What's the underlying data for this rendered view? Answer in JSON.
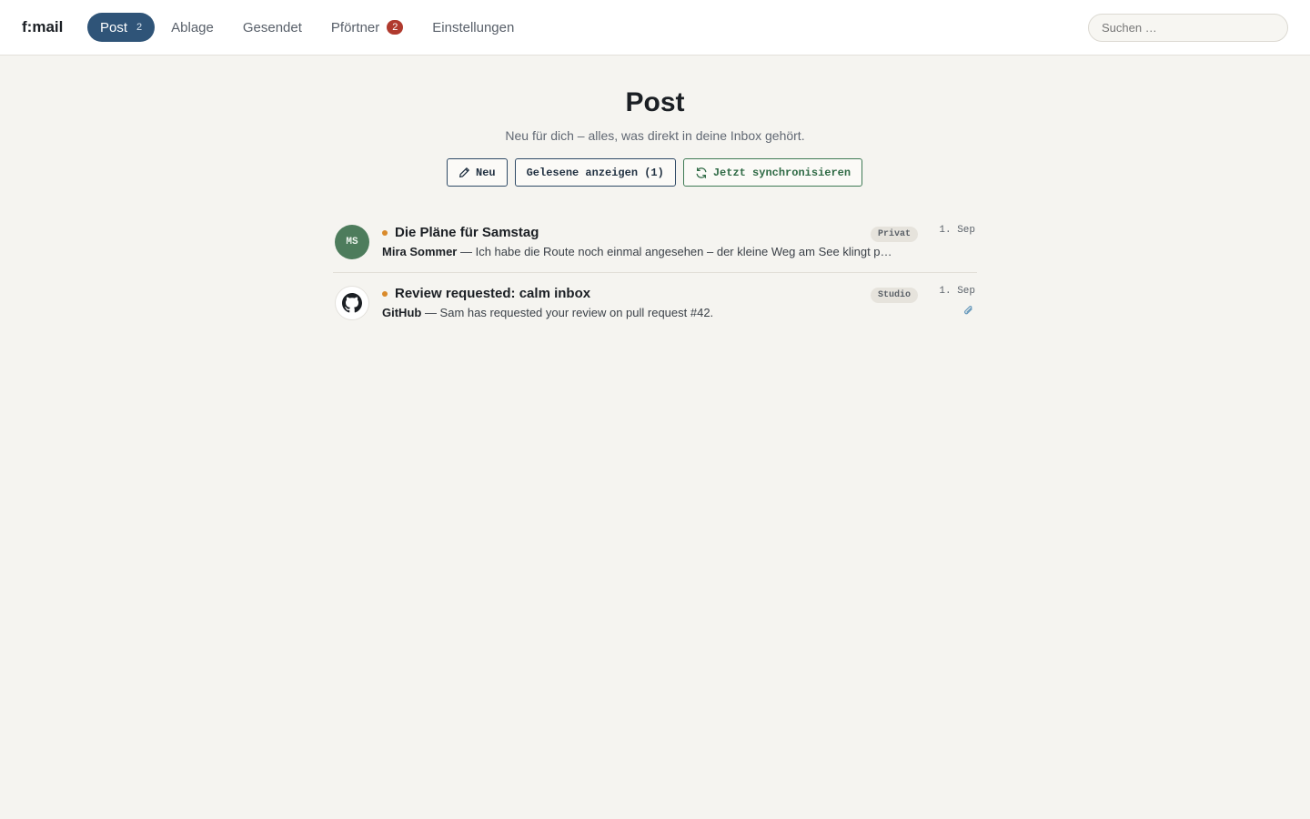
{
  "app": {
    "logo": "f:mail"
  },
  "nav": {
    "items": [
      {
        "label": "Post",
        "count": "2",
        "active": true
      },
      {
        "label": "Ablage"
      },
      {
        "label": "Gesendet"
      },
      {
        "label": "Pförtner",
        "badge": "2"
      },
      {
        "label": "Einstellungen"
      }
    ]
  },
  "search": {
    "placeholder": "Suchen …",
    "value": ""
  },
  "main": {
    "title": "Post",
    "subtitle": "Neu für dich – alles, was direkt in deine Inbox gehört.",
    "actions": {
      "new_label": "Neu",
      "show_read_label": "Gelesene anzeigen (1)",
      "sync_label": "Jetzt synchronisieren"
    }
  },
  "mails": [
    {
      "avatar_initials": "MS",
      "avatar_color": "#4d7c5c",
      "subject": "Die Pläne für Samstag",
      "sender": "Mira Sommer",
      "preview": " — Ich habe die Route noch einmal angesehen – der kleine Weg am See klingt p…",
      "tag": "Privat",
      "date": "1. Sep",
      "unread": true,
      "attachment": false
    },
    {
      "avatar_icon": "github-icon",
      "subject": "Review requested: calm inbox",
      "sender": "GitHub",
      "preview": " — Sam has requested your review on pull request #42.",
      "tag": "Studio",
      "date": "1. Sep",
      "unread": true,
      "attachment": true
    }
  ],
  "colors": {
    "accent": "#2f5478",
    "badge": "#b03a2e",
    "unread_dot": "#d98a2b",
    "sync": "#3f7a55",
    "background": "#f5f4f0"
  }
}
